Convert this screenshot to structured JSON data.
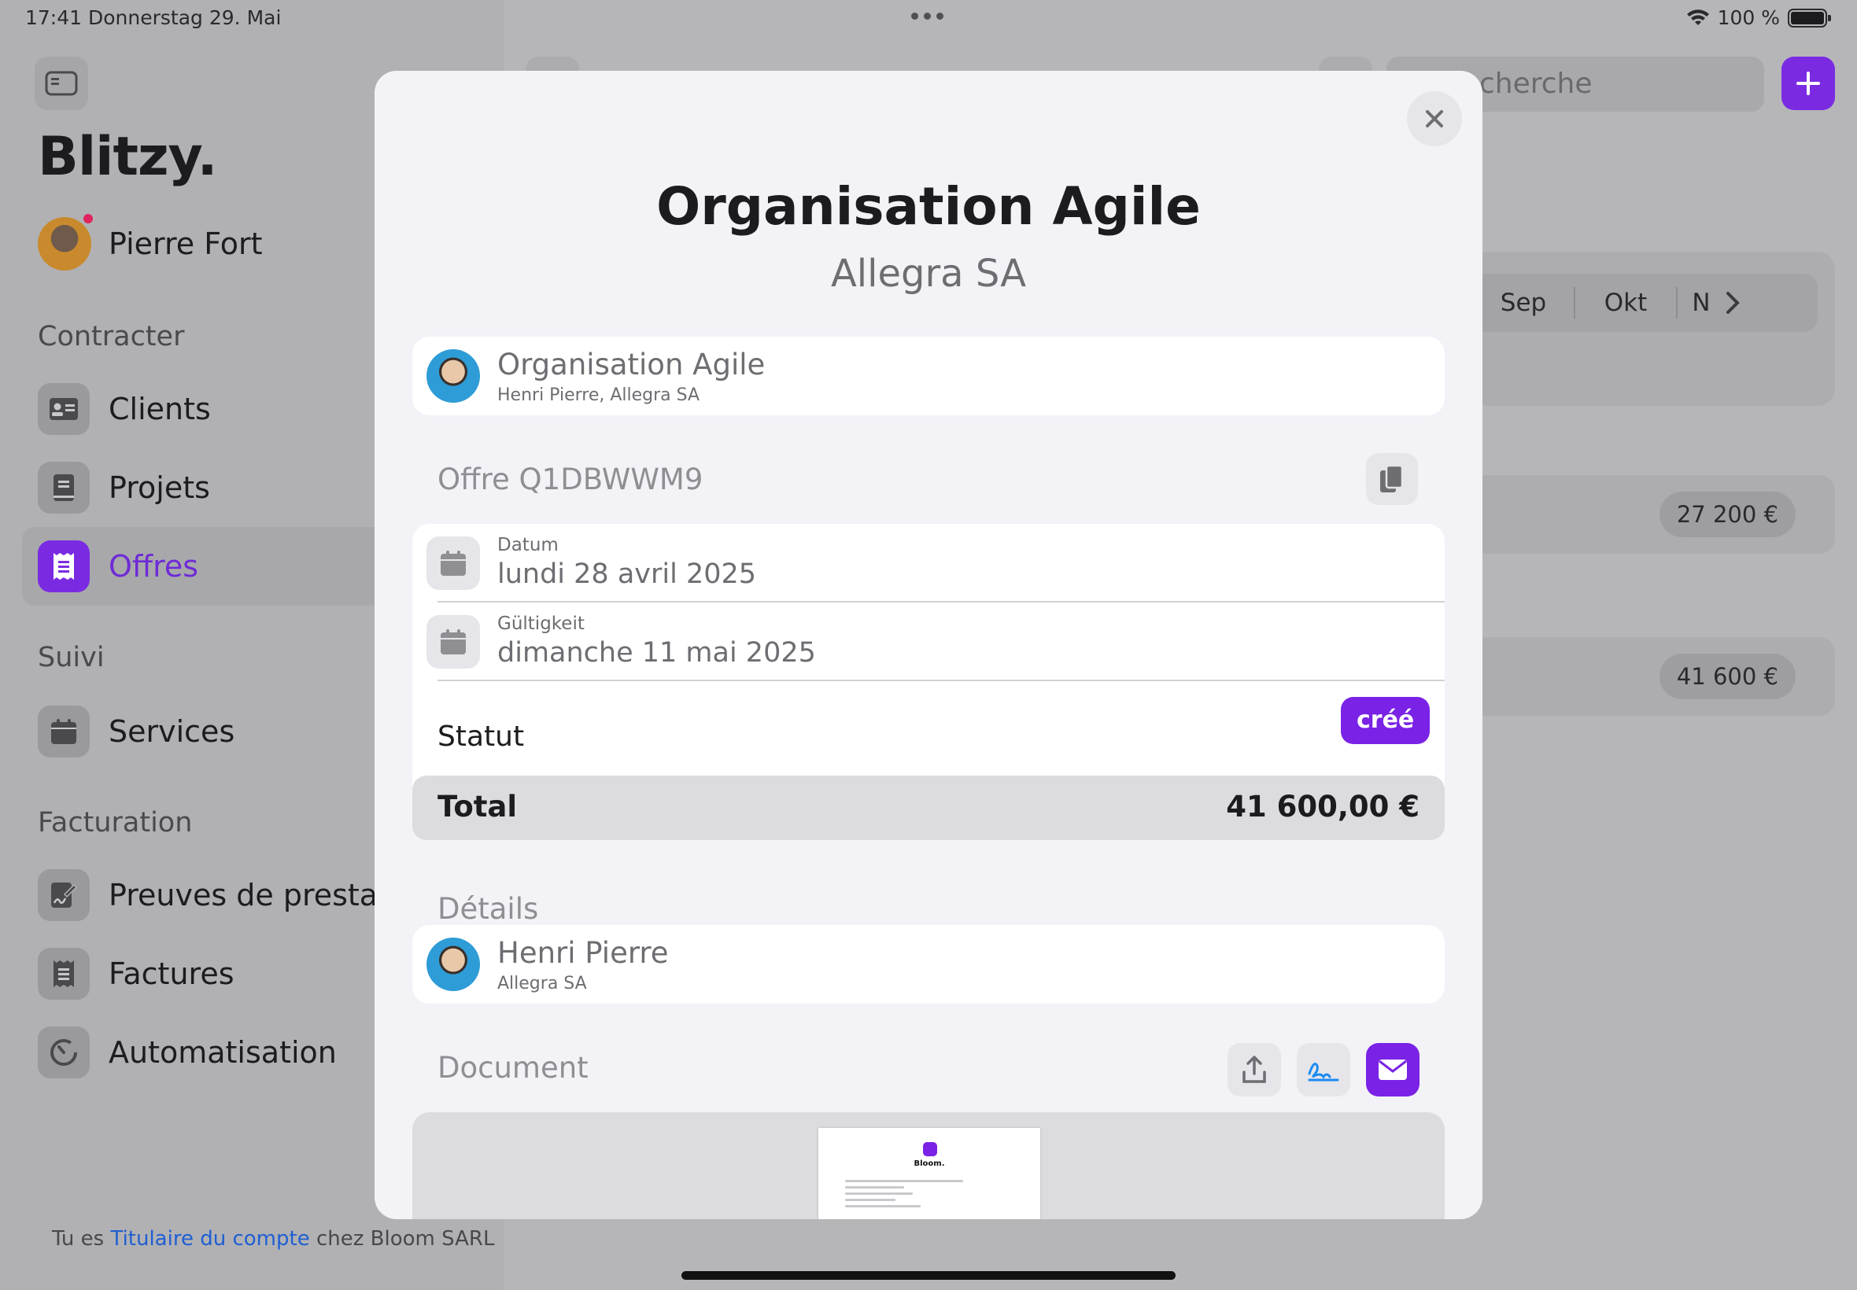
{
  "status_bar": {
    "time": "17:41",
    "date": "Donnerstag 29. Mai",
    "battery": "100 %"
  },
  "sidebar": {
    "brand": "Blitzy.",
    "user_name": "Pierre Fort",
    "sections": [
      {
        "title": "Contracter",
        "items": [
          {
            "label": "Clients",
            "icon": "contact-card-icon"
          },
          {
            "label": "Projets",
            "icon": "book-icon"
          },
          {
            "label": "Offres",
            "icon": "receipt-icon",
            "active": true
          }
        ]
      },
      {
        "title": "Suivi",
        "items": [
          {
            "label": "Services",
            "icon": "calendar-icon"
          }
        ]
      },
      {
        "title": "Facturation",
        "items": [
          {
            "label": "Preuves de prestatio",
            "icon": "signature-doc-icon"
          },
          {
            "label": "Factures",
            "icon": "receipt-icon"
          },
          {
            "label": "Automatisation",
            "icon": "timer-icon"
          }
        ]
      }
    ],
    "footer": {
      "prefix": "Tu es ",
      "link": "Titulaire du compte",
      "suffix": " chez Bloom SARL"
    }
  },
  "background": {
    "search_placeholder": "cherche",
    "months": [
      "Sep",
      "Okt",
      "N"
    ],
    "amounts": [
      "27 200 €",
      "41 600 €"
    ]
  },
  "modal": {
    "title": "Organisation Agile",
    "subtitle": "Allegra SA",
    "project": {
      "title": "Organisation Agile",
      "subtitle": "Henri Pierre, Allegra SA"
    },
    "offer_label": "Offre Q1DBWWM9",
    "date_label": "Datum",
    "date_value": "lundi 28 avril 2025",
    "validity_label": "Gültigkeit",
    "validity_value": "dimanche 11 mai 2025",
    "status_label": "Statut",
    "status_value": "créé",
    "total_label": "Total",
    "total_value": "41 600,00 €",
    "details_label": "Détails",
    "contact": {
      "name": "Henri Pierre",
      "company": "Allegra SA"
    },
    "document_label": "Document",
    "doc_preview_brand": "Bloom."
  },
  "colors": {
    "accent": "#7a22e6",
    "link": "#1f5fd1"
  }
}
